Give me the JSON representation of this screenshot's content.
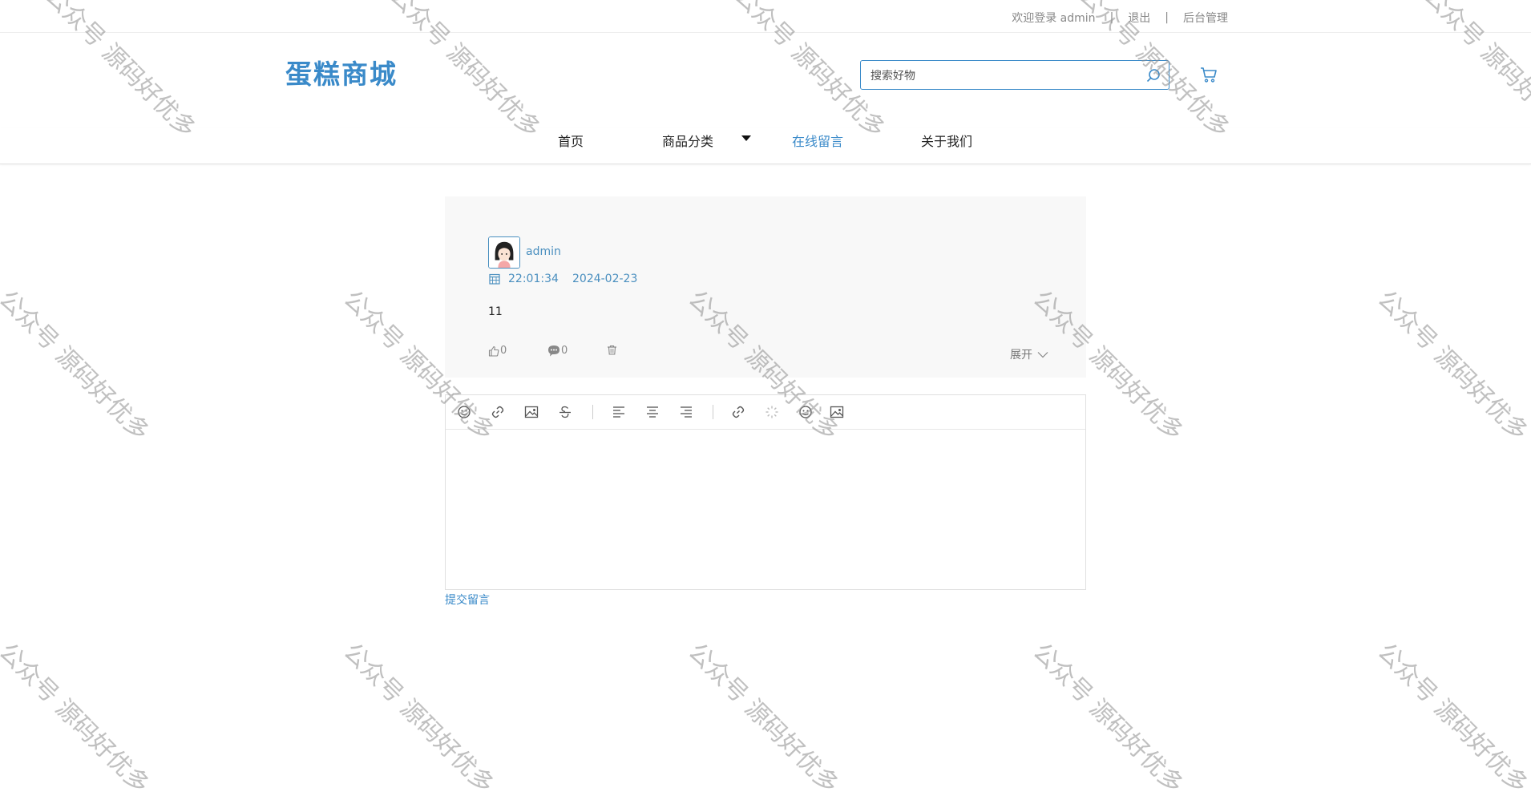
{
  "topbar": {
    "welcome": "欢迎登录 admin",
    "separator": "|",
    "logout": "退出",
    "admin": "后台管理"
  },
  "header": {
    "logo": "蛋糕商城",
    "search_placeholder": "搜索好物",
    "icons": {
      "search": "search-icon",
      "cart": "cart-icon"
    }
  },
  "nav": {
    "items": [
      {
        "label": "首页"
      },
      {
        "label": "商品分类"
      },
      {
        "label": "在线留言"
      },
      {
        "label": "关于我们"
      }
    ],
    "active_index": 2
  },
  "comment": {
    "username": "admin",
    "time": "22:01:34",
    "date": "2024-02-23",
    "content": "11",
    "likes": "0",
    "replies": "0",
    "expand": "展开"
  },
  "editor": {
    "toolbar": [
      "emoji",
      "link",
      "image",
      "strikethrough",
      "align-left",
      "align-center",
      "align-right",
      "link",
      "loading",
      "emoji",
      "image"
    ],
    "submit": "提交留言"
  },
  "watermark": "公众号 源码好优多",
  "colors": {
    "accent": "#3a8ac9",
    "card_bg": "#f8f8f8"
  }
}
